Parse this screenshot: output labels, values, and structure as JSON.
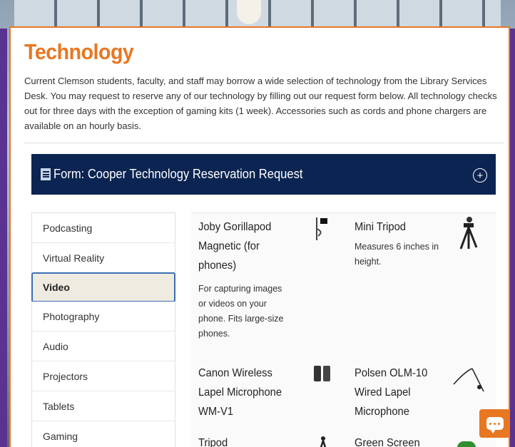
{
  "page": {
    "title": "Technology",
    "intro": "Current Clemson students, faculty, and staff may borrow a wide selection of technology from the Library Services Desk. You may request to reserve any of our technology by filling out our request form below. All technology checks out for three days with the exception of gaming kits (1 week). Accessories such as cords and phone chargers are available on an hourly basis."
  },
  "form": {
    "label": "Form: Cooper Technology Reservation Request",
    "icon": "form-list-icon",
    "expand_icon": "plus-circle-icon"
  },
  "categories": [
    "Podcasting",
    "Virtual Reality",
    "Video",
    "Photography",
    "Audio",
    "Projectors",
    "Tablets",
    "Gaming"
  ],
  "selected_category": "Video",
  "products": [
    {
      "name": "Joby Gorillapod Magnetic (for phones)",
      "description": "For capturing images or videos on your phone.  Fits large-size phones.",
      "image": "phone-tripod-image"
    },
    {
      "name": "Mini Tripod",
      "description": "Measures 6 inches in height.",
      "image": "mini-tripod-image"
    },
    {
      "name": "Canon Wireless Lapel Microphone WM-V1",
      "description": "",
      "image": "wireless-mic-image"
    },
    {
      "name": "Polsen OLM-10 Wired Lapel Microphone",
      "description": "",
      "image": "lapel-mic-image"
    },
    {
      "name": "Tripod",
      "description": "",
      "image": "tripod-image"
    },
    {
      "name": "Green Screen",
      "description": "",
      "image": "green-screen-image"
    }
  ],
  "chat": {
    "icon": "chat-icon"
  },
  "colors": {
    "accent": "#e87722",
    "navy": "#0b2451",
    "purple": "#522d80",
    "active_border": "#3a6fb7"
  }
}
